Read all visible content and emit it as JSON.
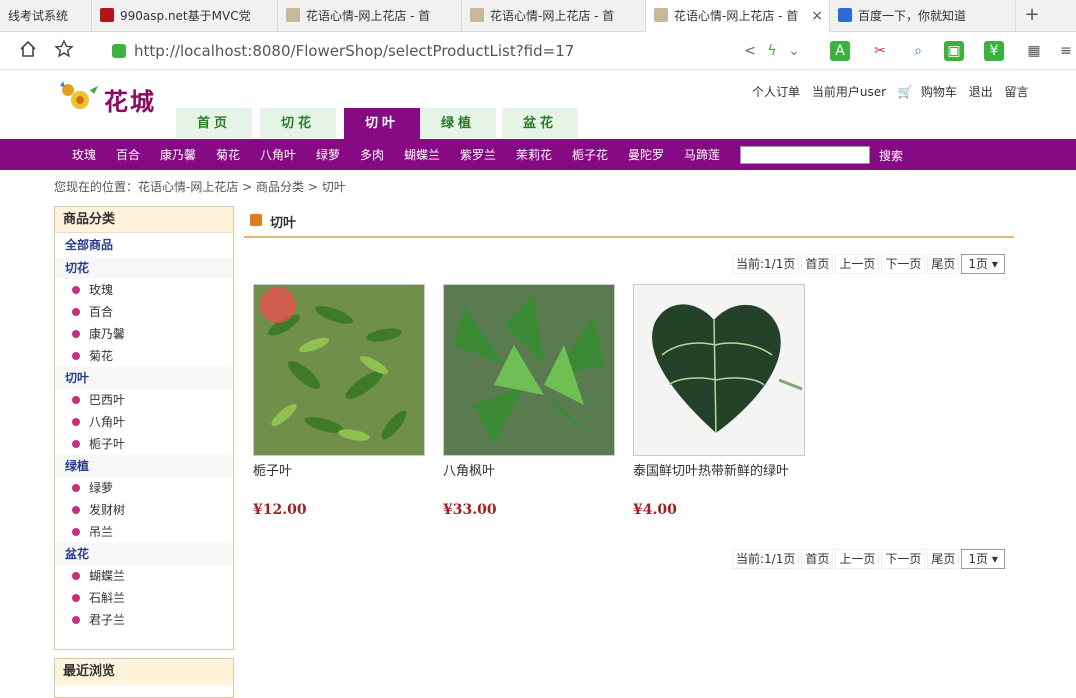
{
  "browser": {
    "tabs": [
      {
        "title": "线考试系统",
        "active": false
      },
      {
        "title": "990asp.net基于MVC党",
        "active": false
      },
      {
        "title": "花语心情-网上花店 - 首",
        "active": false
      },
      {
        "title": "花语心情-网上花店 - 首",
        "active": false
      },
      {
        "title": "花语心情-网上花店 - 首",
        "active": true
      },
      {
        "title": "百度一下，你就知道",
        "active": false
      }
    ],
    "close_glyph": "×",
    "new_tab_glyph": "+",
    "url": "http://localhost:8080/FlowerShop/selectProductList?fid=17"
  },
  "header": {
    "logo_text": "花城",
    "user_links": {
      "orders": "个人订单",
      "current_user": "当前用户user",
      "cart": "购物车",
      "logout": "退出",
      "message": "留言"
    },
    "main_tabs": [
      "首页",
      "切花",
      "切叶",
      "绿植",
      "盆花"
    ],
    "active_tab": "切叶"
  },
  "catbar": {
    "links": [
      "玫瑰",
      "百合",
      "康乃馨",
      "菊花",
      "八角叶",
      "绿萝",
      "多肉",
      "蝴蝶兰",
      "紫罗兰",
      "茉莉花",
      "栀子花",
      "曼陀罗",
      "马蹄莲"
    ],
    "search_placeholder": "",
    "search_button": "搜索"
  },
  "breadcrumb": {
    "prefix": "您现在的位置：",
    "home": "花语心情-网上花店",
    "sep": " > ",
    "category": "商品分类",
    "current": "切叶"
  },
  "sidebar": {
    "title": "商品分类",
    "all": "全部商品",
    "groups": [
      {
        "name": "切花",
        "items": [
          "玫瑰",
          "百合",
          "康乃馨",
          "菊花"
        ]
      },
      {
        "name": "切叶",
        "items": [
          "巴西叶",
          "八角叶",
          "栀子叶"
        ]
      },
      {
        "name": "绿植",
        "items": [
          "绿萝",
          "发财树",
          "吊兰"
        ]
      },
      {
        "name": "盆花",
        "items": [
          "蝴蝶兰",
          "石斛兰",
          "君子兰"
        ]
      }
    ],
    "recent_title": "最近浏览"
  },
  "content": {
    "title": "切叶",
    "pager": {
      "current": "当前:1/1页",
      "first": "首页",
      "prev": "上一页",
      "next": "下一页",
      "last": "尾页",
      "select": "1页 ▾"
    },
    "products": [
      {
        "name": "栀子叶",
        "price": "¥12.00"
      },
      {
        "name": "八角枫叶",
        "price": "¥33.00"
      },
      {
        "name": "泰国鲜切叶热带新鲜的绿叶",
        "price": "¥4.00"
      }
    ]
  },
  "colors": {
    "accent": "#870a85",
    "tab_bg": "#e6f4e6",
    "price": "#a02020"
  }
}
